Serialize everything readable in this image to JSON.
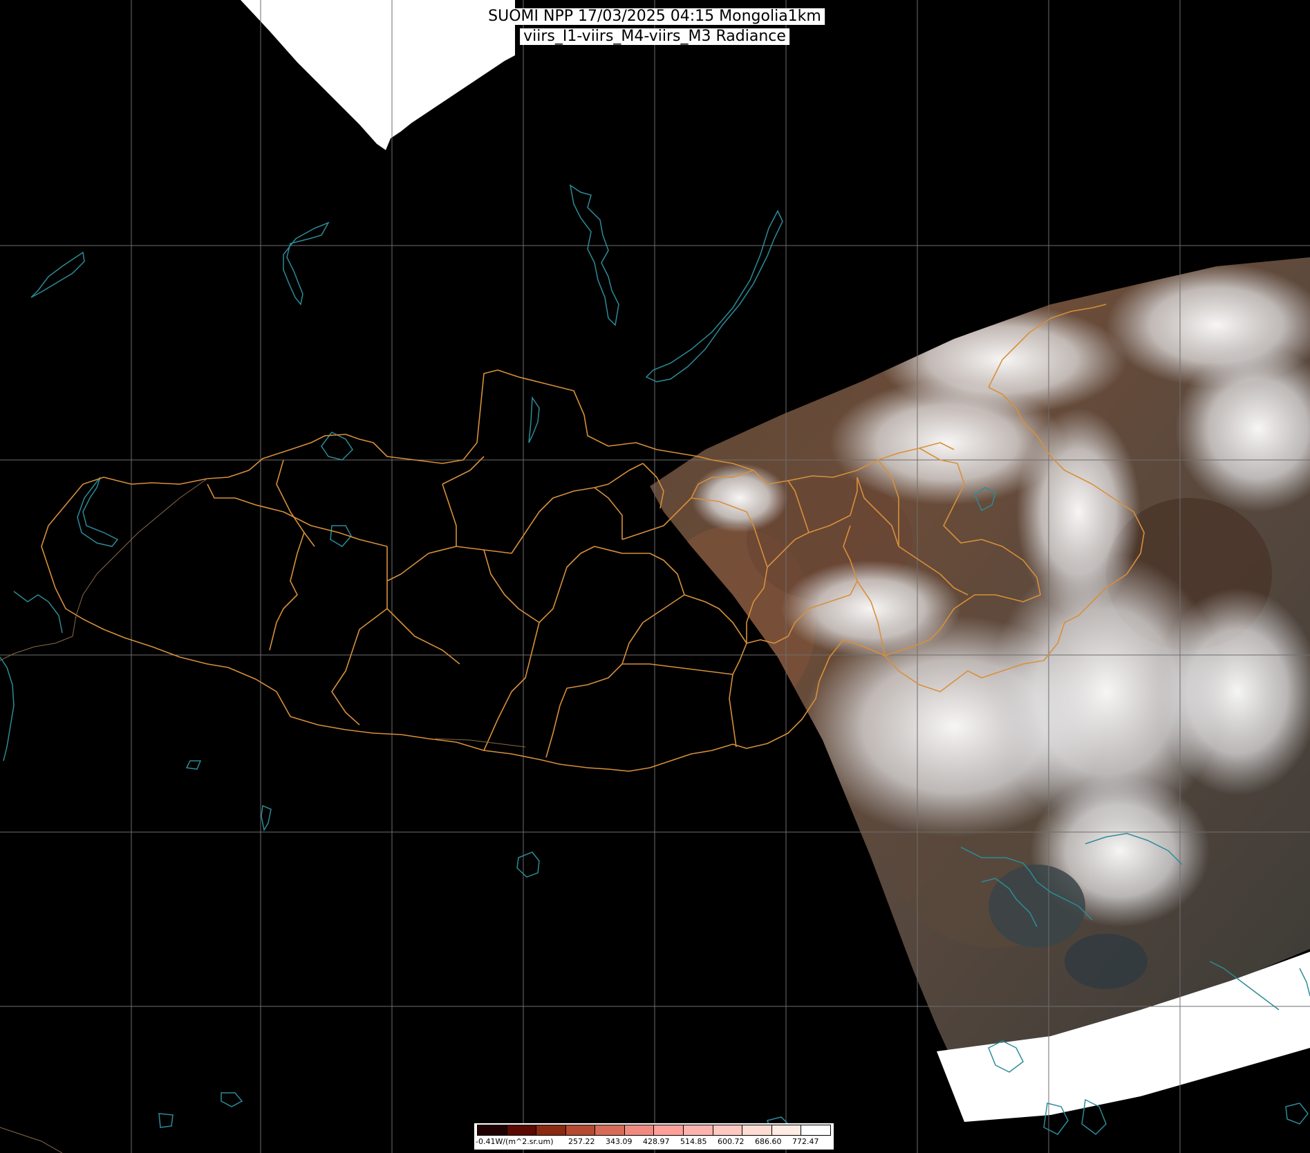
{
  "title": {
    "line1": "SUOMI NPP 17/03/2025 04:15 Mongolia1km",
    "line2": "viirs_I1-viirs_M4-viirs_M3 Radiance"
  },
  "legend": {
    "unit_label": "-0.41W/(m^2.sr.um)",
    "ticks": [
      "257.22",
      "343.09",
      "428.97",
      "514.85",
      "600.72",
      "686.60",
      "772.47"
    ],
    "colors": [
      "#200000",
      "#5a0a00",
      "#8a2a10",
      "#b54a30",
      "#d86a58",
      "#f08a80",
      "#ff9f9a",
      "#ffb3ae",
      "#ffc8c0",
      "#ffdcd2",
      "#ffece4",
      "#ffffff"
    ]
  },
  "map_colors": {
    "background": "#000000",
    "graticule": "#6e6e6e",
    "coastline": "#2c8c98",
    "admin_border": "#d8903a",
    "no_data": "#ffffff"
  }
}
